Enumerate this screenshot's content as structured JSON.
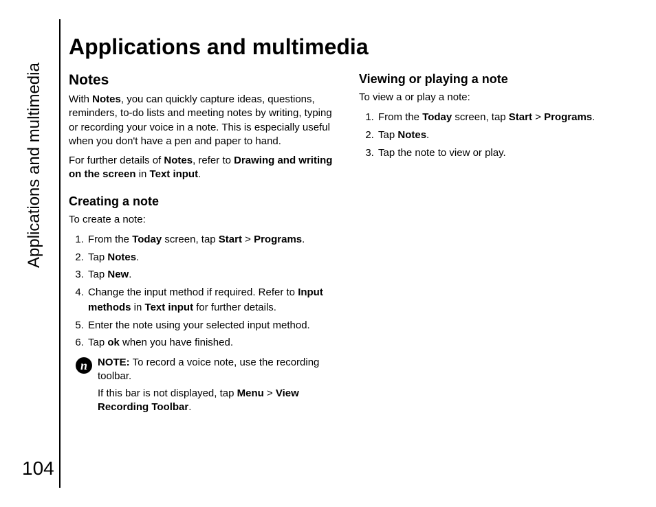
{
  "sideLabel": "Applications and multimedia",
  "pageNumber": "104",
  "title": "Applications and multimedia",
  "left": {
    "heading": "Notes",
    "p1": {
      "pre": "With ",
      "b1": "Notes",
      "post": ", you can quickly capture ideas, questions, reminders, to-do lists and meeting notes by writing, typing or recording your voice in a note. This is especially useful when you don't have a pen and paper to hand."
    },
    "p2": {
      "pre": "For further details of ",
      "b1": "Notes",
      "mid1": ", refer to ",
      "b2": "Drawing and writing on the screen",
      "mid2": " in ",
      "b3": "Text input",
      "post": "."
    },
    "sub1": "Creating a note",
    "create_intro": "To create a note:",
    "steps": {
      "s1": {
        "pre": "From the ",
        "b1": "Today",
        "mid1": " screen, tap ",
        "b2": "Start",
        "mid2": " > ",
        "b3": "Programs",
        "post": "."
      },
      "s2": {
        "pre": "Tap ",
        "b1": "Notes",
        "post": "."
      },
      "s3": {
        "pre": "Tap ",
        "b1": "New",
        "post": "."
      },
      "s4": {
        "pre": "Change the input method if required. Refer to ",
        "b1": "Input methods",
        "mid1": " in ",
        "b2": "Text input",
        "post": " for further details."
      },
      "s5": {
        "pre": "Enter the note using your selected input method.",
        "b1": "",
        "post": ""
      },
      "s6": {
        "pre": "Tap ",
        "b1": "ok",
        "post": " when you have finished."
      }
    },
    "note": {
      "glyph": "n",
      "p1": {
        "b1": "NOTE:",
        "post": " To record a voice note, use the recording toolbar."
      },
      "p2": {
        "pre": "If this bar is not displayed, tap ",
        "b1": "Menu",
        "mid1": " > ",
        "b2": "View Recording Toolbar",
        "post": "."
      }
    }
  },
  "right": {
    "heading": "Viewing or playing a note",
    "intro": "To view a or play a note:",
    "steps": {
      "s1": {
        "pre": "From the ",
        "b1": "Today",
        "mid1": " screen, tap ",
        "b2": "Start",
        "mid2": " > ",
        "b3": "Programs",
        "post": "."
      },
      "s2": {
        "pre": "Tap ",
        "b1": "Notes",
        "post": "."
      },
      "s3": {
        "pre": "Tap the note to view or play.",
        "b1": "",
        "post": ""
      }
    }
  }
}
